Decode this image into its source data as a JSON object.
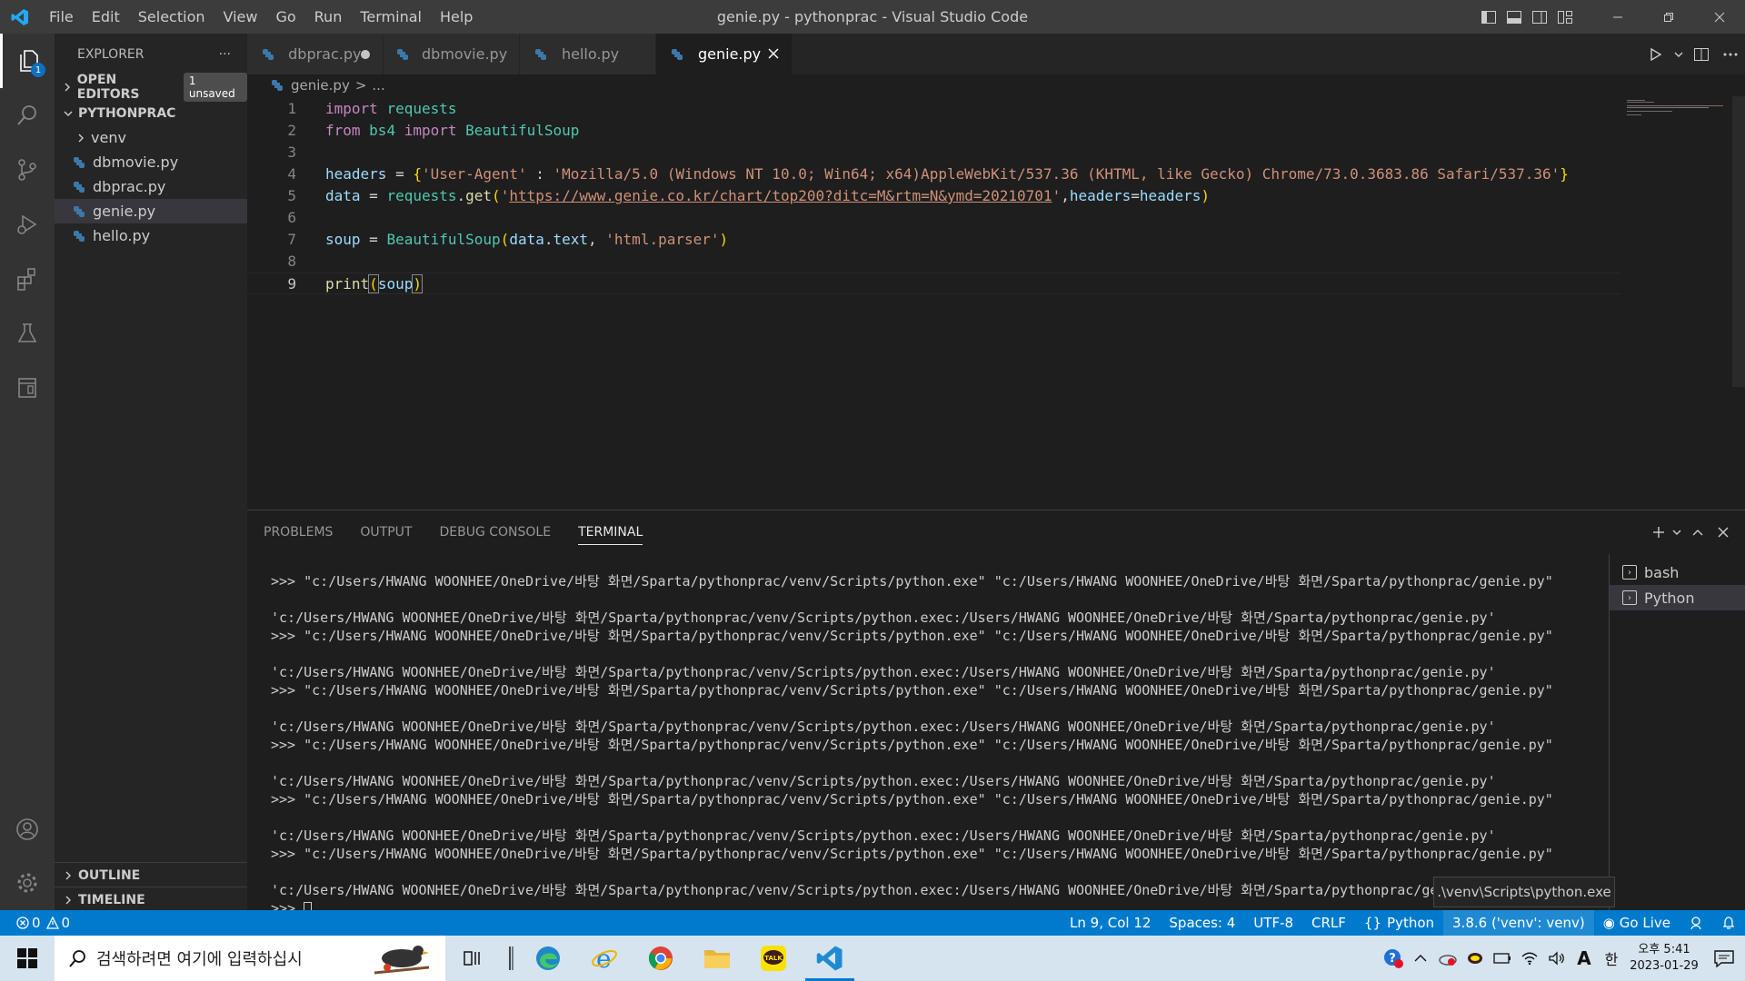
{
  "window": {
    "title": "genie.py - pythonprac - Visual Studio Code",
    "menu": [
      "File",
      "Edit",
      "Selection",
      "View",
      "Go",
      "Run",
      "Terminal",
      "Help"
    ]
  },
  "activity": {
    "explorer_badge": "1"
  },
  "sidebar": {
    "title": "EXPLORER",
    "more": "···",
    "open_editors": "OPEN EDITORS",
    "unsaved_badge": "1 unsaved",
    "project": "PYTHONPRAC",
    "folder": "venv",
    "files": [
      "dbmovie.py",
      "dbprac.py",
      "genie.py",
      "hello.py"
    ],
    "outline": "OUTLINE",
    "timeline": "TIMELINE"
  },
  "tabs": [
    {
      "name": "dbprac.py"
    },
    {
      "name": "dbmovie.py"
    },
    {
      "name": "hello.py"
    },
    {
      "name": "genie.py"
    }
  ],
  "breadcrumb": {
    "file": "genie.py",
    "sep": ">",
    "rest": "..."
  },
  "editor": {
    "line_numbers": [
      "1",
      "2",
      "3",
      "4",
      "5",
      "6",
      "7",
      "8",
      "9"
    ],
    "tokens": {
      "import": "import",
      "requests": "requests",
      "from": "from",
      "bs4": "bs4",
      "BeautifulSoup": "BeautifulSoup",
      "headers": "headers",
      "eq": " = ",
      "lbrace": "{",
      "ua_key": "'User-Agent'",
      "colon": " : ",
      "ua_val": "'Mozilla/5.0 (Windows NT 10.0; Win64; x64)AppleWebKit/537.36 (KHTML, like Gecko) Chrome/73.0.3683.86 Safari/537.36'",
      "rbrace": "}",
      "data": "data",
      "dot": ".",
      "get": "get",
      "lparen": "(",
      "url_q1": "'",
      "url": "https://www.genie.co.kr/chart/top200?ditc=M&rtm=N&ymd=20210701",
      "url_q2": "'",
      "comma": ",",
      "headers_kw": "headers",
      "assign": "=",
      "headers_val": "headers",
      "rparen": ")",
      "soup": "soup",
      "text": "text",
      "comma_sp": ", ",
      "parser": "'html.parser'",
      "print": "print"
    }
  },
  "panel": {
    "tabs": [
      "PROBLEMS",
      "OUTPUT",
      "DEBUG CONSOLE",
      "TERMINAL"
    ],
    "active_tab": "TERMINAL",
    "terminal": {
      "cmd": ">>> \"c:/Users/HWANG WOONHEE/OneDrive/바탕 화면/Sparta/pythonprac/venv/Scripts/python.exe\" \"c:/Users/HWANG WOONHEE/OneDrive/바탕 화면/Sparta/pythonprac/genie.py\"",
      "out": "'c:/Users/HWANG WOONHEE/OneDrive/바탕 화면/Sparta/pythonprac/venv/Scripts/python.exec:/Users/HWANG WOONHEE/OneDrive/바탕 화면/Sparta/pythonprac/genie.py'",
      "prompt": ">>> "
    },
    "terminals": [
      "bash",
      "Python"
    ],
    "tooltip": ".\\venv\\Scripts\\python.exe"
  },
  "status": {
    "errors": "0",
    "warnings": "0",
    "position": "Ln 9, Col 12",
    "spaces": "Spaces: 4",
    "encoding": "UTF-8",
    "eol": "CRLF",
    "language": "Python",
    "interpreter": "3.8.6 ('venv': venv)",
    "golive": "Go Live"
  },
  "taskbar": {
    "search_placeholder": "검색하려면 여기에 입력하십시",
    "ime": "한",
    "font_a": "A",
    "kakao": "TALK",
    "time": "오후 5:41",
    "date": "2023-01-29"
  }
}
